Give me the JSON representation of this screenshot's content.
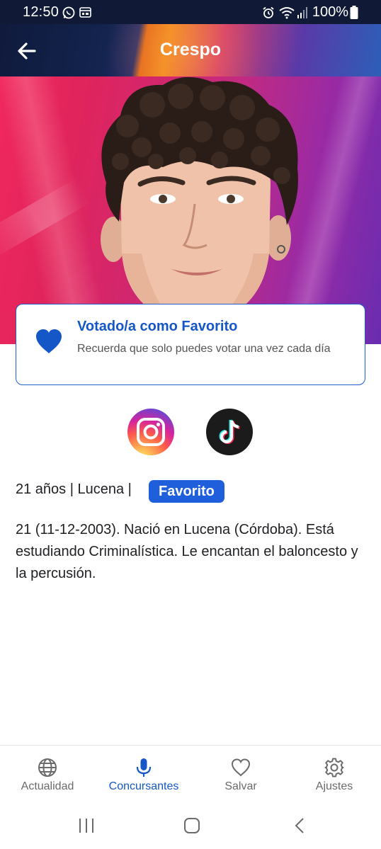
{
  "status_bar": {
    "time": "12:50",
    "battery": "100%",
    "icons": [
      "whatsapp-icon",
      "calendar-icon",
      "alarm-icon",
      "wifi-icon",
      "signal-icon",
      "battery-icon"
    ]
  },
  "header": {
    "title": "Crespo",
    "back_icon": "arrow-left-icon"
  },
  "hero": {
    "image": "contestant-portrait"
  },
  "vote_card": {
    "icon": "heart-icon",
    "title": "Votado/a como Favorito",
    "subtitle": "Recuerda que solo puedes votar una vez cada día"
  },
  "social": {
    "instagram": "instagram-icon",
    "tiktok": "tiktok-icon"
  },
  "info": {
    "meta": "21 años | Lucena |",
    "badge": "Favorito",
    "bio": "21 (11-12-2003). Nació en Lucena (Córdoba). Está estudiando Criminalística. Le encantan el baloncesto y la percusión."
  },
  "bottom_nav": {
    "items": [
      {
        "label": "Actualidad",
        "icon": "globe-icon",
        "active": false
      },
      {
        "label": "Concursantes",
        "icon": "microphone-icon",
        "active": true
      },
      {
        "label": "Salvar",
        "icon": "heart-outline-icon",
        "active": false
      },
      {
        "label": "Ajustes",
        "icon": "gear-icon",
        "active": false
      }
    ]
  },
  "colors": {
    "accent": "#1557c7",
    "badge": "#1f5fdc",
    "status_bar": "#101a36"
  }
}
